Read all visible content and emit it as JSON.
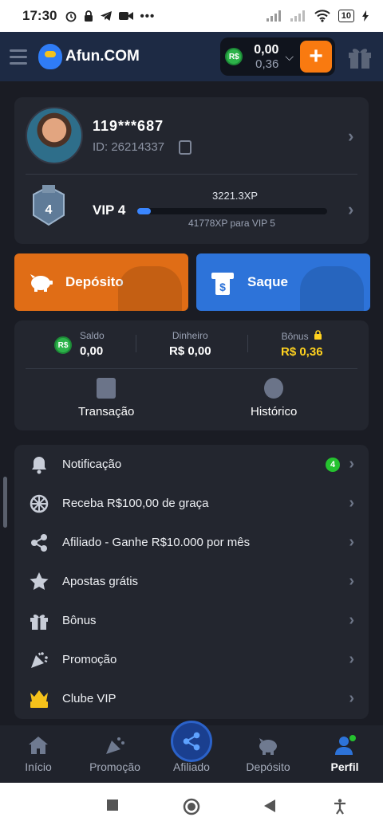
{
  "status_bar": {
    "time": "17:30",
    "icons": [
      "alarm-icon",
      "lock-icon",
      "telegram-icon",
      "video-icon",
      "more-icon"
    ],
    "battery": "10"
  },
  "app_bar": {
    "logo_text": "Afun.COM",
    "currency_symbol": "R$",
    "balance_main": "0,00",
    "balance_sub": "0,36",
    "add_label": "+"
  },
  "profile": {
    "username": "119***687",
    "user_id": "ID: 26214337",
    "vip_level_badge": "4",
    "vip_label": "VIP 4",
    "xp_value": "3221.3XP",
    "xp_next": "41778XP para VIP 5",
    "xp_progress_percent": 7
  },
  "actions": {
    "deposit_label": "Depósito",
    "withdraw_label": "Saque"
  },
  "wallet": {
    "saldo_label": "Saldo",
    "saldo_value": "0,00",
    "dinheiro_label": "Dinheiro",
    "dinheiro_value": "R$ 0,00",
    "bonus_label": "Bônus",
    "bonus_value": "R$ 0,36",
    "transacao_label": "Transação",
    "historico_label": "Histórico"
  },
  "menu": [
    {
      "label": "Notificação",
      "icon": "bell-icon",
      "badge": "4"
    },
    {
      "label": "Receba R$100,00 de graça",
      "icon": "wheel-icon"
    },
    {
      "label": "Afiliado - Ganhe R$10.000 por mês",
      "icon": "share-icon"
    },
    {
      "label": "Apostas grátis",
      "icon": "free-star-icon"
    },
    {
      "label": "Bônus",
      "icon": "gift-icon"
    },
    {
      "label": "Promoção",
      "icon": "party-icon"
    },
    {
      "label": "Clube VIP",
      "icon": "vip-crown-icon"
    }
  ],
  "bottom_nav": [
    {
      "label": "Início",
      "icon": "home-icon"
    },
    {
      "label": "Promoção",
      "icon": "party-icon"
    },
    {
      "label": "Afiliado",
      "icon": "share-icon"
    },
    {
      "label": "Depósito",
      "icon": "piggy-bank-icon"
    },
    {
      "label": "Perfil",
      "icon": "user-icon",
      "active": true
    }
  ],
  "colors": {
    "accent_orange": "#f97a10",
    "accent_blue": "#2d73d9",
    "bonus_yellow": "#ffd21f",
    "badge_green": "#25c22f"
  }
}
